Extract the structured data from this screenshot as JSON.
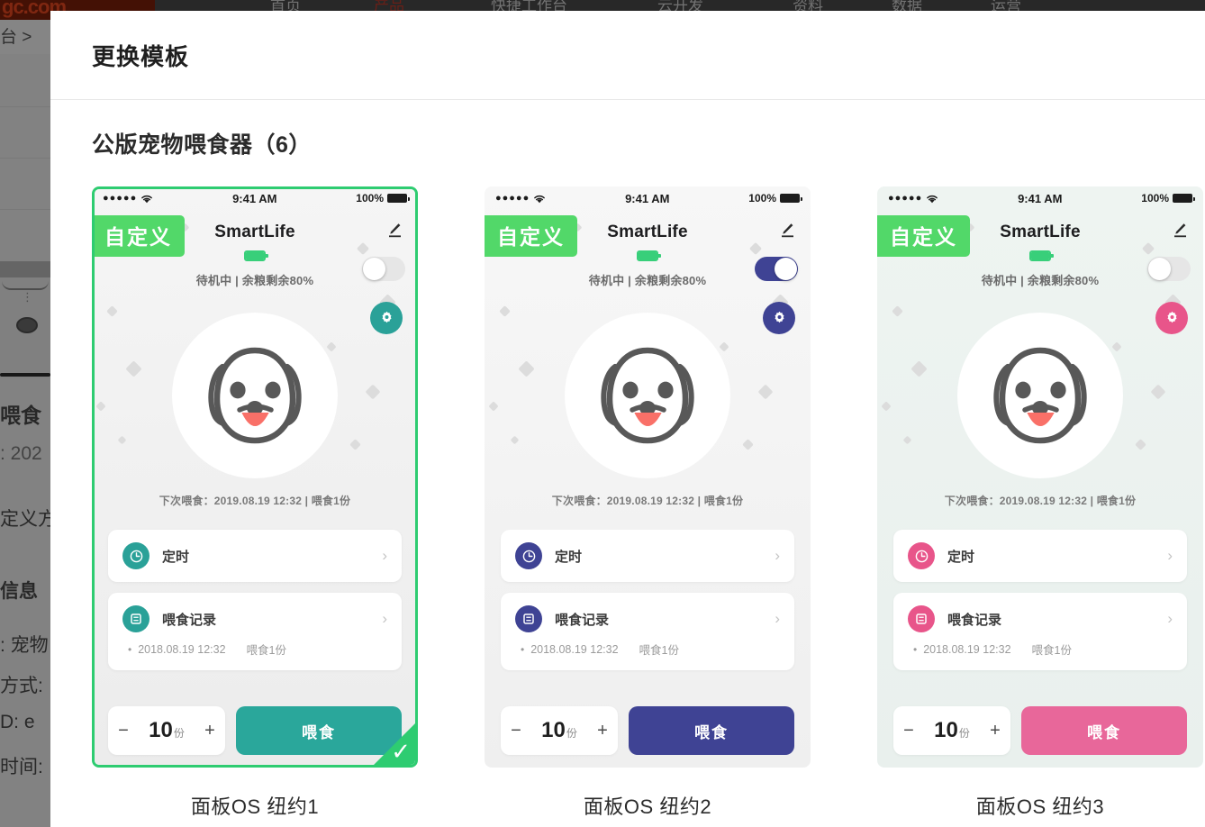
{
  "background_page": {
    "logo_text": "gc.com",
    "nav_items": [
      "首页",
      "产品",
      "快捷工作台",
      "云开发",
      "资料",
      "数据",
      "运营"
    ],
    "breadcrumb": "台 >",
    "texts": [
      "喂食",
      ": 202",
      "定义方:",
      "信息",
      ": 宠物",
      "方式:",
      "D: e",
      "时间:"
    ]
  },
  "modal": {
    "title": "更换模板",
    "section_title": "公版宠物喂食器（6）"
  },
  "shared": {
    "status_dots": "●●●●●",
    "status_time": "9:41 AM",
    "battery_percent": "100%",
    "badge_label": "自定义",
    "app_title": "SmartLife",
    "device_status": "待机中 | 余粮剩余80%",
    "next_feed": "下次喂食：2019.08.19 12:32 | 喂食1份",
    "timer_label": "定时",
    "record_label": "喂食记录",
    "record_time": "2018.08.19 12:32",
    "record_amount": "喂食1份",
    "stepper_minus": "−",
    "stepper_plus": "+",
    "stepper_value": "10",
    "stepper_unit": "份",
    "feed_button": "喂食",
    "chevron": "›",
    "bullet": "•",
    "check_mark": "✓",
    "battery_icon_name": "battery-icon",
    "wifi_icon_name": "wifi-icon",
    "pencil_icon_name": "pencil-edit-icon",
    "gear_icon_name": "gear-settings-icon",
    "clock_icon_name": "clock-icon",
    "list-icon_name": "list-record-icon",
    "dog_icon_name": "dog-face-icon"
  },
  "templates": [
    {
      "caption": "面板OS 纽约1",
      "accent": "#2aa198",
      "accent_soft": "#2aa198",
      "bg_top": "#f5f5f5",
      "bg_bottom": "#ececec",
      "toggle_state": "off",
      "selected": true,
      "feed_btn_color": "#2aa79b"
    },
    {
      "caption": "面板OS 纽约2",
      "accent": "#3f4394",
      "accent_soft": "#3f4394",
      "bg_top": "#f7f7f7",
      "bg_bottom": "#efefef",
      "toggle_state": "on",
      "selected": false,
      "feed_btn_color": "#3f4394"
    },
    {
      "caption": "面板OS 纽约3",
      "accent": "#e8558a",
      "accent_soft": "#e8558a",
      "bg_top": "#eef4f1",
      "bg_bottom": "#e9f0ed",
      "toggle_state": "off",
      "selected": false,
      "feed_btn_color": "#e8679a"
    }
  ]
}
